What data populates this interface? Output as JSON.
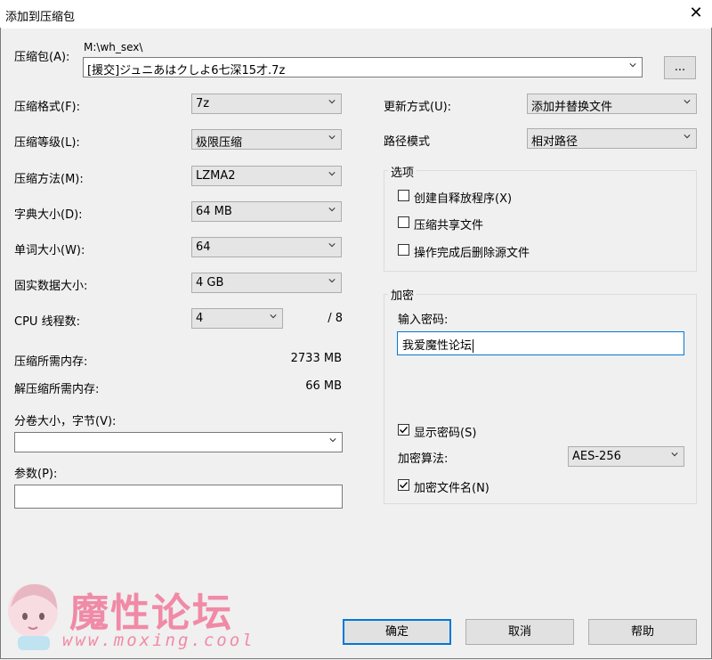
{
  "window": {
    "title": "添加到压缩包"
  },
  "archive": {
    "label": "压缩包(A):",
    "path": "M:\\wh_sex\\",
    "filename": "[援交]ジュニあはクしよ6七深15才.7z",
    "browse_label": "..."
  },
  "left": {
    "format": {
      "label": "压缩格式(F):",
      "value": "7z"
    },
    "level": {
      "label": "压缩等级(L):",
      "value": "极限压缩"
    },
    "method": {
      "label": "压缩方法(M):",
      "value": "LZMA2"
    },
    "dict": {
      "label": "字典大小(D):",
      "value": "64 MB"
    },
    "word": {
      "label": "单词大小(W):",
      "value": "64"
    },
    "solid": {
      "label": "固实数据大小:",
      "value": "4 GB"
    },
    "threads": {
      "label": "CPU 线程数:",
      "value": "4",
      "max": "/ 8"
    },
    "mem_compress": {
      "label": "压缩所需内存:",
      "value": "2733 MB"
    },
    "mem_decompress": {
      "label": "解压缩所需内存:",
      "value": "66 MB"
    },
    "volume": {
      "label": "分卷大小，字节(V):",
      "value": ""
    },
    "params": {
      "label": "参数(P):",
      "value": ""
    }
  },
  "right": {
    "update": {
      "label": "更新方式(U):",
      "value": "添加并替换文件"
    },
    "pathmode": {
      "label": "路径模式",
      "value": "相对路径"
    },
    "options": {
      "title": "选项",
      "sfx": {
        "label": "创建自释放程序(X)",
        "checked": false
      },
      "shared": {
        "label": "压缩共享文件",
        "checked": false
      },
      "delete": {
        "label": "操作完成后删除源文件",
        "checked": false
      }
    },
    "encryption": {
      "title": "加密",
      "password_label": "输入密码:",
      "password": "我爱魔性论坛",
      "show_password": {
        "label": "显示密码(S)",
        "checked": true
      },
      "method_label": "加密算法:",
      "method_value": "AES-256",
      "encrypt_names": {
        "label": "加密文件名(N)",
        "checked": true
      }
    }
  },
  "buttons": {
    "ok": "确定",
    "cancel": "取消",
    "help": "帮助"
  },
  "watermark": {
    "text": "魔性论坛",
    "url": "www.moxing.cool"
  }
}
